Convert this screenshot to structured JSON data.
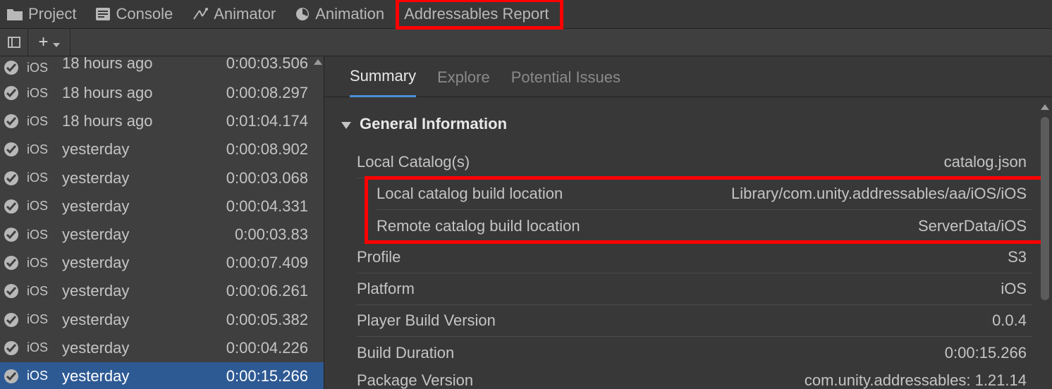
{
  "tabs": {
    "project": "Project",
    "console": "Console",
    "animator": "Animator",
    "animation": "Animation",
    "addressables_report": "Addressables Report"
  },
  "builds": [
    {
      "platform": "iOS",
      "time": "18 hours ago",
      "duration": "0:00:03.506"
    },
    {
      "platform": "iOS",
      "time": "18 hours ago",
      "duration": "0:00:08.297"
    },
    {
      "platform": "iOS",
      "time": "18 hours ago",
      "duration": "0:01:04.174"
    },
    {
      "platform": "iOS",
      "time": "yesterday",
      "duration": "0:00:08.902"
    },
    {
      "platform": "iOS",
      "time": "yesterday",
      "duration": "0:00:03.068"
    },
    {
      "platform": "iOS",
      "time": "yesterday",
      "duration": "0:00:04.331"
    },
    {
      "platform": "iOS",
      "time": "yesterday",
      "duration": "0:00:03.83"
    },
    {
      "platform": "iOS",
      "time": "yesterday",
      "duration": "0:00:07.409"
    },
    {
      "platform": "iOS",
      "time": "yesterday",
      "duration": "0:00:06.261"
    },
    {
      "platform": "iOS",
      "time": "yesterday",
      "duration": "0:00:05.382"
    },
    {
      "platform": "iOS",
      "time": "yesterday",
      "duration": "0:00:04.226"
    },
    {
      "platform": "iOS",
      "time": "yesterday",
      "duration": "0:00:15.266"
    }
  ],
  "selected_build_index": 11,
  "right_tabs": {
    "summary": "Summary",
    "explore": "Explore",
    "potential_issues": "Potential Issues"
  },
  "section_title": "General Information",
  "info": {
    "local_catalogs_label": "Local Catalog(s)",
    "local_catalogs_value": "catalog.json",
    "local_build_loc_label": "Local catalog build location",
    "local_build_loc_value": "Library/com.unity.addressables/aa/iOS/iOS",
    "remote_build_loc_label": "Remote catalog build location",
    "remote_build_loc_value": "ServerData/iOS",
    "profile_label": "Profile",
    "profile_value": "S3",
    "platform_label": "Platform",
    "platform_value": "iOS",
    "player_ver_label": "Player Build Version",
    "player_ver_value": "0.0.4",
    "build_dur_label": "Build Duration",
    "build_dur_value": "0:00:15.266",
    "pkg_ver_label": "Package Version",
    "pkg_ver_value": "com.unity.addressables: 1.21.14"
  }
}
